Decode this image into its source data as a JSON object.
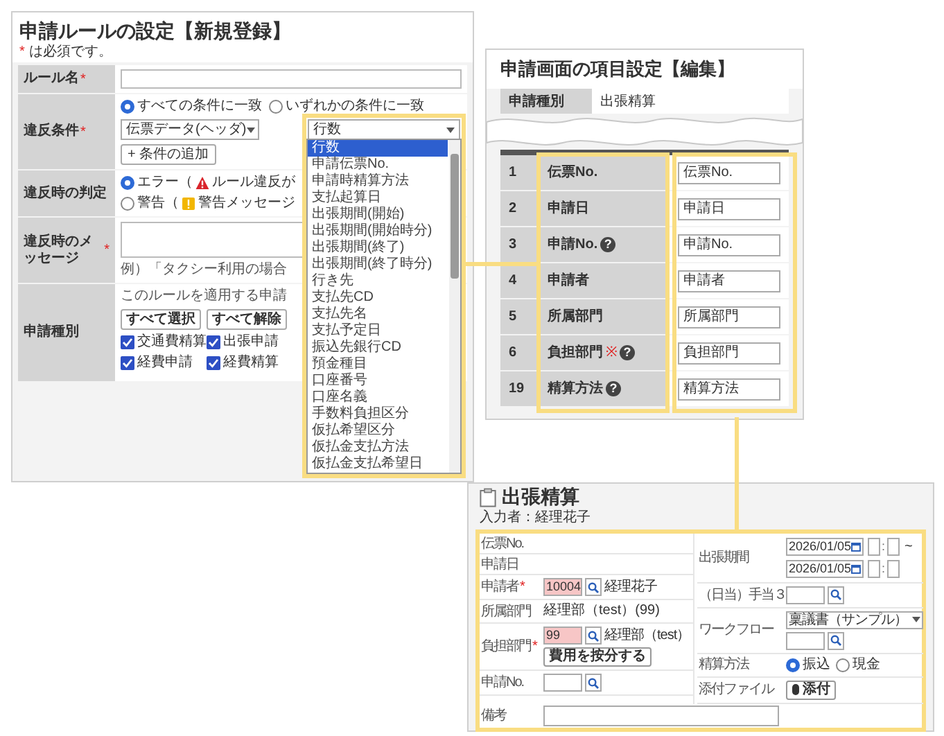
{
  "rule_panel": {
    "title": "申請ルールの設定【新規登録】",
    "note": {
      "mark": "*",
      "text": "は必須です。"
    },
    "rows": [
      {
        "kind": "text",
        "label": "ルール名",
        "required_mark": "*"
      },
      {
        "kind": "conditions",
        "label": "違反条件",
        "required_mark": "*",
        "match_options": [
          {
            "label": "すべての条件に一致",
            "selected": true
          },
          {
            "label": "いずれかの条件に一致",
            "selected": false
          }
        ],
        "source_select": "伝票データ(ヘッダ)",
        "field_select": "行数",
        "add_button": "+ 条件の追加"
      },
      {
        "kind": "judgement",
        "label": "違反時の判定",
        "options": [
          {
            "label": "エラー（",
            "kind": "error",
            "note": "ルール違反が",
            "selected": true
          },
          {
            "label": "警告（",
            "kind": "warning",
            "note": "警告メッセージ",
            "selected": false
          }
        ]
      },
      {
        "kind": "message",
        "label": "違反時のメッセージ",
        "required_mark": "*",
        "hint": "例）「タクシー利用の場合"
      },
      {
        "kind": "doc_types",
        "label": "申請種別",
        "hint": "このルールを適用する申請",
        "buttons": [
          "すべて選択",
          "すべて解除"
        ],
        "types": [
          {
            "label": "交通費精算",
            "checked": true
          },
          {
            "label": "出張申請",
            "checked": true
          },
          {
            "label": "経費申請",
            "checked": true
          },
          {
            "label": "経費精算",
            "checked": true
          }
        ]
      }
    ],
    "dropdown": {
      "items": [
        {
          "label": "行数",
          "selected": true
        },
        {
          "label": "申請伝票No.",
          "selected": false
        },
        {
          "label": "申請時精算方法",
          "selected": false
        },
        {
          "label": "支払起算日",
          "selected": false
        },
        {
          "label": "出張期間(開始)",
          "selected": false
        },
        {
          "label": "出張期間(開始時分)",
          "selected": false
        },
        {
          "label": "出張期間(終了)",
          "selected": false
        },
        {
          "label": "出張期間(終了時分)",
          "selected": false
        },
        {
          "label": "行き先",
          "selected": false
        },
        {
          "label": "支払先CD",
          "selected": false
        },
        {
          "label": "支払先名",
          "selected": false
        },
        {
          "label": "支払予定日",
          "selected": false
        },
        {
          "label": "振込先銀行CD",
          "selected": false
        },
        {
          "label": "預金種目",
          "selected": false
        },
        {
          "label": "口座番号",
          "selected": false
        },
        {
          "label": "口座名義",
          "selected": false
        },
        {
          "label": "手数料負担区分",
          "selected": false
        },
        {
          "label": "仮払希望区分",
          "selected": false
        },
        {
          "label": "仮払金支払方法",
          "selected": false
        },
        {
          "label": "仮払金支払希望日",
          "selected": false
        }
      ]
    }
  },
  "field_panel": {
    "title": "申請画面の項目設定【編集】",
    "type_label": "申請種別",
    "type_value": "出張精算",
    "rows": [
      {
        "no": "1",
        "label": "伝票No.",
        "value": "伝票No."
      },
      {
        "no": "2",
        "label": "申請日",
        "value": "申請日"
      },
      {
        "no": "3",
        "label": "申請No.",
        "help": "?",
        "value": "申請No."
      },
      {
        "no": "4",
        "label": "申請者",
        "value": "申請者"
      },
      {
        "no": "5",
        "label": "所属部門",
        "value": "所属部門"
      },
      {
        "no": "6",
        "label": "負担部門",
        "required_mark": "※",
        "help": "?",
        "value": "負担部門"
      },
      {
        "no": "19",
        "label": "精算方法",
        "help": "?",
        "value": "精算方法"
      }
    ]
  },
  "expense_panel": {
    "title": "出張精算",
    "entered_by": "入力者：経理花子",
    "left": [
      {
        "kind": "plain",
        "label": "伝票No."
      },
      {
        "kind": "plain",
        "label": "申請日"
      },
      {
        "kind": "lookup",
        "label": "申請者",
        "required_mark": "*",
        "value": "10004",
        "name": "経理花子",
        "highlight": true
      },
      {
        "kind": "text",
        "label": "所属部門",
        "text": "経理部（test）(99)"
      },
      {
        "kind": "lookup",
        "label": "負担部門",
        "required_mark": "*",
        "value": "99",
        "name": "経理部（test）",
        "highlight": true,
        "button": "費用を按分する"
      },
      {
        "kind": "lookup",
        "label": "申請No.",
        "highlight": false
      }
    ],
    "right": [
      {
        "kind": "period",
        "label": "出張期間",
        "dates": [
          {
            "date": "2026/01/05",
            "colon": ":",
            "suffix": "~"
          },
          {
            "date": "2026/01/05",
            "colon": ":"
          }
        ]
      },
      {
        "kind": "lookup",
        "label": "（日当）手当３",
        "highlight": false
      },
      {
        "kind": "workflow",
        "label": "ワークフロー",
        "select": "稟議書（サンプル）"
      },
      {
        "kind": "radio",
        "label": "精算方法",
        "options": [
          {
            "label": "振込",
            "selected": true
          },
          {
            "label": "現金",
            "selected": false
          }
        ]
      },
      {
        "kind": "attach",
        "label": "添付ファイル",
        "button": "添付"
      }
    ],
    "remarks_label": "備考"
  }
}
